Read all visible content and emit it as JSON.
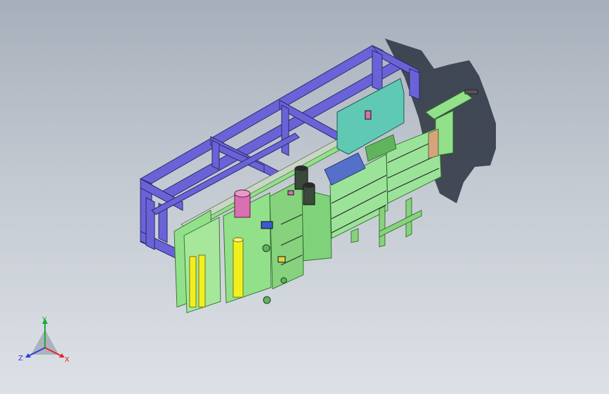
{
  "viewport": {
    "background_top": "#a7afbb",
    "background_bottom": "#dde1e7"
  },
  "triad": {
    "y_label": "Y",
    "z_label": "Z",
    "x_label": "X",
    "x_color": "#e0262a",
    "y_color": "#23a636",
    "z_color": "#2f3fd8"
  },
  "model_colors": {
    "frame": "#6a63d8",
    "frame_edge": "#2b2a6a",
    "plate": "#93e08a",
    "plate_dark": "#5fb45c",
    "panel_teal": "#5fc9b4",
    "cylinder_yellow": "#f2ef1f",
    "motor_magenta": "#d86fae",
    "shadow": "#2c3340"
  }
}
